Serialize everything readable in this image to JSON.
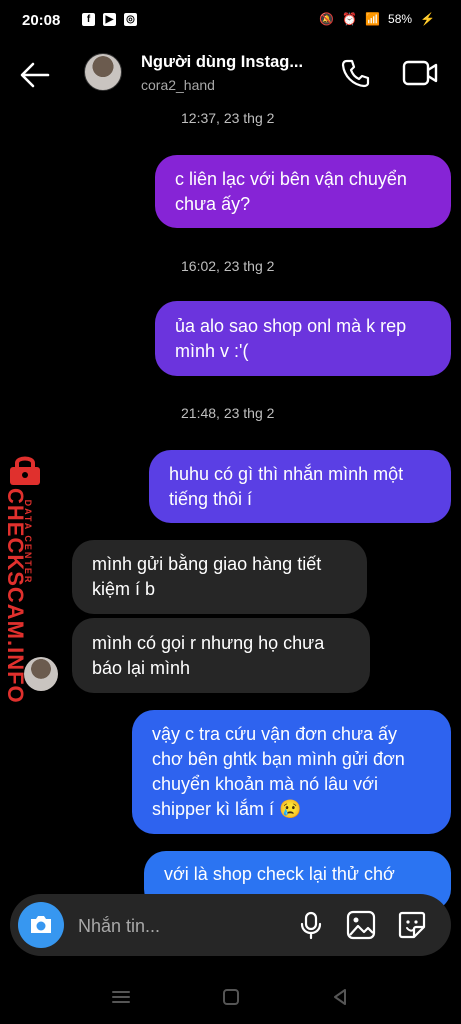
{
  "status_bar": {
    "time": "20:08",
    "battery": "58%"
  },
  "header": {
    "name": "Người dùng Instag...",
    "handle": "cora2_hand"
  },
  "watermark": {
    "brand": "CHECKSCAM.INFO",
    "sub": "DATA CENTER"
  },
  "messages": [
    {
      "type": "timestamp",
      "text": "12:37, 23 thg 2"
    },
    {
      "type": "sent",
      "text": "c liên lạc với bên vận chuyển\nchưa ấy?"
    },
    {
      "type": "timestamp",
      "text": "16:02, 23 thg 2"
    },
    {
      "type": "sent",
      "text": "ủa alo sao shop onl mà k rep\nmình v :'("
    },
    {
      "type": "timestamp",
      "text": "21:48, 23 thg 2"
    },
    {
      "type": "sent",
      "text": "huhu có gì thì nhắn mình một\ntiếng thôi í"
    },
    {
      "type": "received",
      "text": "mình gửi bằng giao hàng tiết\nkiệm í b"
    },
    {
      "type": "received",
      "text": "mình có gọi r nhưng họ chưa\nbáo lại mình"
    },
    {
      "type": "sent",
      "text": "vậy c tra cứu vận đơn chưa ấy\nchơ bên ghtk bạn mình gửi đơn\nchuyển khoản mà nó lâu với\nshipper kì lắm í 😢"
    },
    {
      "type": "sent",
      "text": "với là shop check lại thử chớ"
    }
  ],
  "composer": {
    "placeholder": "Nhắn tin..."
  },
  "colors": {
    "sent_purple": "#8624d6",
    "sent_blue": "#2e63ef",
    "received": "#262626",
    "camera": "#3797f0",
    "watermark": "#e0302d"
  }
}
